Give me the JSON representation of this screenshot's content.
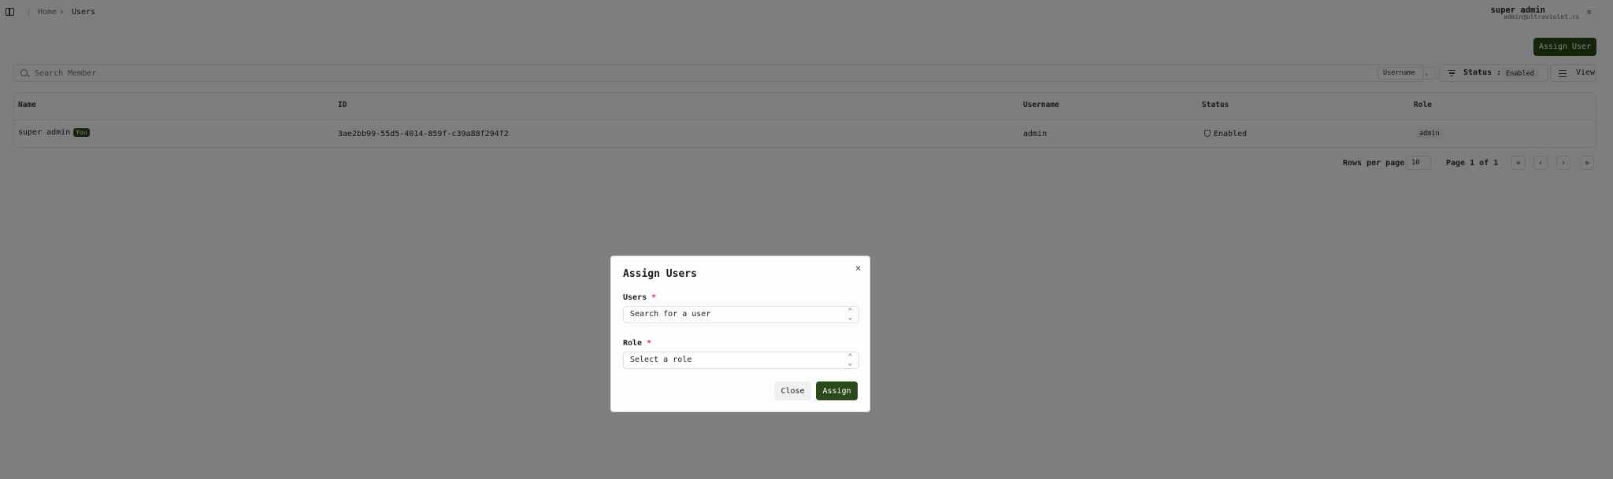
{
  "breadcrumb": {
    "home": "Home",
    "separator": "›",
    "current": "Users"
  },
  "account": {
    "name": "super admin",
    "email": "admin@ultraviolet.rs",
    "menu_icon": "≡"
  },
  "toolbar": {
    "assign_user": "Assign User",
    "search_placeholder": "Search Member",
    "search_field": "Username",
    "status_label": "Status :",
    "status_value": "Enabled",
    "view_label": "View"
  },
  "table": {
    "columns": [
      "Name",
      "ID",
      "Username",
      "Status",
      "Role"
    ],
    "rows": [
      {
        "name": "super admin",
        "badge": "You",
        "id": "3ae2bb99-55d5-4014-859f-c39a88f294f2",
        "username": "admin",
        "status": "Enabled",
        "role": "admin"
      }
    ]
  },
  "pagination": {
    "rows_per_page_label": "Rows per page",
    "rows_per_page": "10",
    "page_text": "Page 1 of 1",
    "first": "«",
    "prev": "‹",
    "next": "›",
    "last": "»"
  },
  "dialog": {
    "title": "Assign Users",
    "close_icon": "×",
    "users_label": "Users",
    "users_placeholder": "Search for a user",
    "role_label": "Role",
    "role_placeholder": "Select a role",
    "required_mark": "*",
    "updown_icon": "⌃⌄",
    "close_button": "Close",
    "assign_button": "Assign"
  }
}
